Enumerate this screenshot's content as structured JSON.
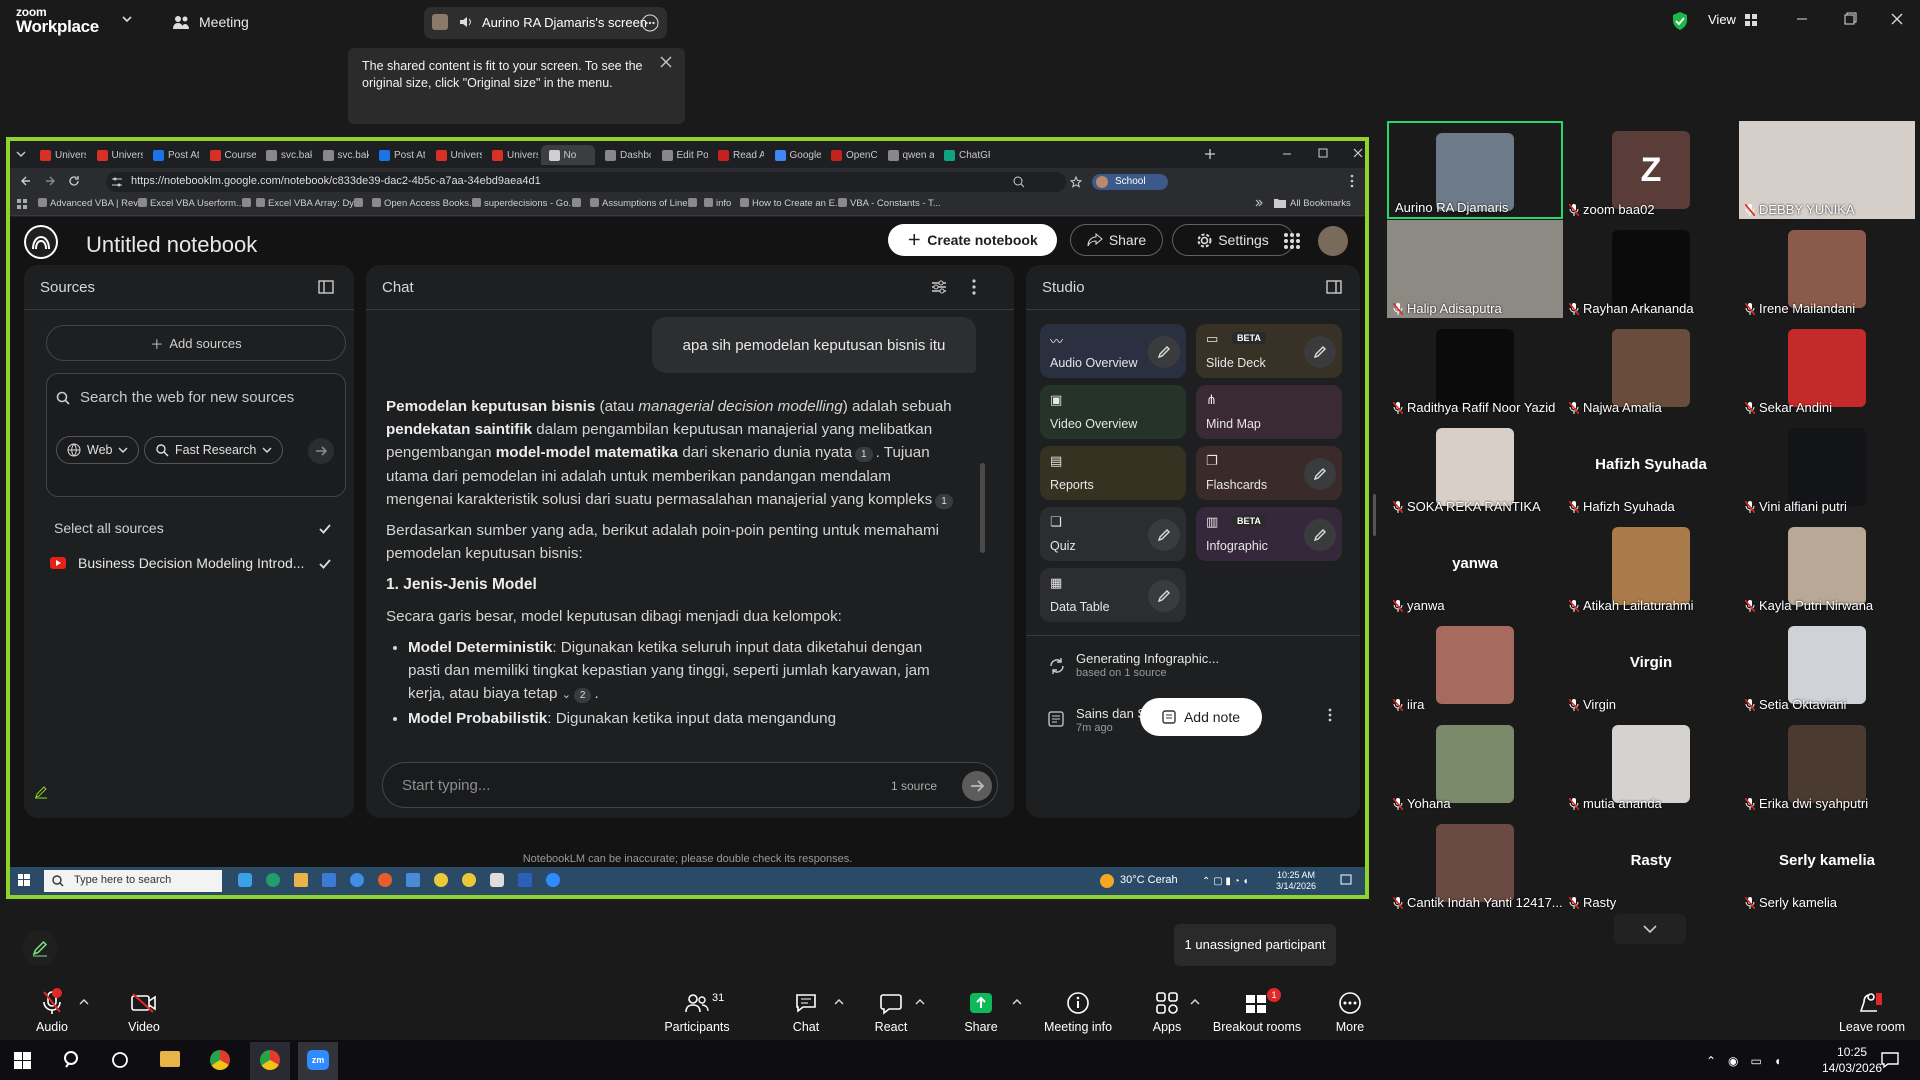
{
  "zoom": {
    "logo_small": "zoom",
    "logo_big": "Workplace",
    "meeting_label": "Meeting",
    "share_title": "Aurino RA Djamaris's screen",
    "view_label": "View",
    "notice": "The shared content is fit to your screen. To see the original size, click \"Original size\" in the menu.",
    "unassigned": "1 unassigned participant",
    "controls": {
      "audio": "Audio",
      "video": "Video",
      "participants": "Participants",
      "participants_count": "31",
      "chat": "Chat",
      "react": "React",
      "share": "Share",
      "meeting_info": "Meeting info",
      "apps": "Apps",
      "breakout": "Breakout rooms",
      "breakout_badge": "1",
      "more": "More",
      "leave": "Leave room"
    },
    "colors": {
      "accent": "#8fd42a",
      "share": "#0fb95a",
      "danger": "#e02828"
    }
  },
  "browser": {
    "tabs": [
      "Univers",
      "Univers",
      "Post At",
      "Course",
      "svc.bak",
      "svc.bak",
      "Post At",
      "Univers",
      "Univers",
      "No",
      "Dashbo",
      "Edit Po",
      "Read Al",
      "Google",
      "OpenCl",
      "qwen a",
      "ChatGP"
    ],
    "url": "https://notebooklm.google.com/notebook/c833de39-dac2-4b5c-a7aa-34ebd9aea4d1",
    "profile_label": "School",
    "bookmarks": [
      "Advanced VBA | Rev...",
      "Excel VBA Userform...",
      "",
      "Excel VBA Array: Dy...",
      "",
      "Open Access Books...",
      "superdecisions - Go...",
      "",
      "Assumptions of Line...",
      "",
      "info",
      "How to Create an E...",
      "VBA - Constants - T..."
    ],
    "all_bookmarks": "All Bookmarks"
  },
  "notebook": {
    "title": "Untitled notebook",
    "create_label": "Create notebook",
    "share_label": "Share",
    "settings_label": "Settings",
    "sources": {
      "title": "Sources",
      "add_label": "Add sources",
      "search_placeholder": "Search the web for new sources",
      "web_chip": "Web",
      "research_chip": "Fast Research",
      "select_all": "Select all sources",
      "item": "Business Decision Modeling Introd..."
    },
    "chat": {
      "title": "Chat",
      "user_msg": "apa sih  pemodelan keputusan bisnis itu",
      "input_placeholder": "Start typing...",
      "source_count": "1 source",
      "answer": {
        "p1_b1": "Pemodelan keputusan bisnis",
        "p1_t1": " (atau ",
        "p1_i1": "managerial decision modelling",
        "p1_t2": ") adalah sebuah ",
        "p1_b2": "pendekatan saintifik",
        "p1_t3": " dalam pengambilan keputusan manajerial yang melibatkan pengembangan ",
        "p1_b3": "model-model matematika",
        "p1_t4": " dari skenario dunia nyata",
        "ref1": "1",
        "p1_t5": ". Tujuan utama dari pemodelan ini adalah untuk memberikan pandangan mendalam mengenai karakteristik solusi dari suatu permasalahan manajerial yang kompleks",
        "ref2": "1",
        "p2": "Berdasarkan sumber yang ada, berikut adalah poin-poin penting untuk memahami pemodelan keputusan bisnis:",
        "h1": "1. Jenis-Jenis Model",
        "p3": "Secara garis besar, model keputusan dibagi menjadi dua kelompok:",
        "li1_b": "Model Deterministik",
        "li1_t": ": Digunakan ketika seluruh input data diketahui dengan pasti dan memiliki tingkat kepastian yang tinggi, seperti jumlah karyawan, jam kerja, atau biaya tetap",
        "ref3": "2",
        "li2_b": "Model Probabilistik",
        "li2_t": ": Digunakan ketika input data mengandung"
      }
    },
    "studio": {
      "title": "Studio",
      "tiles": [
        "Audio Overview",
        "Slide Deck",
        "Video Overview",
        "Mind Map",
        "Reports",
        "Flashcards",
        "Quiz",
        "Infographic",
        "Data Table"
      ],
      "beta": "BETA",
      "generating": "Generating Infographic...",
      "generating_sub": "based on 1 source",
      "note_title": "Sains dan Strategi Pemodelan...",
      "note_time": "7m ago",
      "add_note": "Add note"
    },
    "disclaimer": "NotebookLM can be inaccurate; please double check its responses."
  },
  "inner_taskbar": {
    "search": "Type here to search",
    "weather": "30°C  Cerah",
    "time": "10:25 AM",
    "date": "3/14/2026"
  },
  "participants": [
    {
      "name": "Aurino RA Djamaris",
      "muted": false,
      "color": "#6d7a8a"
    },
    {
      "name": "zoom baa02",
      "muted": true,
      "initial": "Z",
      "color": "#5a3d38"
    },
    {
      "name": "DEBBY YUNIKA",
      "muted": true,
      "color": "#c9bfbb"
    },
    {
      "name": "Halip Adisaputra",
      "muted": true,
      "color": "#8f8a82"
    },
    {
      "name": "Rayhan Arkananda",
      "muted": true,
      "color": "#0b0b0b"
    },
    {
      "name": "Irene Mailandani",
      "muted": true,
      "color": "#8a5a4a"
    },
    {
      "name": "Radithya Rafif Noor Yazid",
      "muted": true,
      "color": "#0b0b0b"
    },
    {
      "name": "Najwa Amalia",
      "muted": true,
      "color": "#6a4c3c"
    },
    {
      "name": "Sekar Andini",
      "muted": true,
      "color": "#c42a2a"
    },
    {
      "name": "SOKA REKA RANTIKA",
      "muted": true,
      "color": "#d8cfc8"
    },
    {
      "name": "Hafizh Syuhada",
      "muted": true,
      "big": "Hafizh Syuhada"
    },
    {
      "name": "Vini alfiani putri",
      "muted": true,
      "color": "#121418"
    },
    {
      "name": "yanwa",
      "muted": true,
      "big": "yanwa"
    },
    {
      "name": "Atikah Lailaturahmi",
      "muted": true,
      "color": "#a97b4b"
    },
    {
      "name": "Kayla Putri Nirwana",
      "muted": true,
      "color": "#b9a896"
    },
    {
      "name": "iira",
      "muted": true,
      "color": "#a76a5e"
    },
    {
      "name": "Virgin",
      "muted": true,
      "big": "Virgin"
    },
    {
      "name": "Setia Oktaviani",
      "muted": true,
      "color": "#cfd2d6"
    },
    {
      "name": "Yohana",
      "muted": true,
      "color": "#7a8a6a"
    },
    {
      "name": "mutia ananda",
      "muted": true,
      "color": "#d6d2cf"
    },
    {
      "name": "Erika dwi syahputri",
      "muted": true,
      "color": "#4a3a30"
    },
    {
      "name": "Cantik Indah Yanti 12417...",
      "muted": true,
      "color": "#6c4a44"
    },
    {
      "name": "Rasty",
      "muted": true,
      "big": "Rasty"
    },
    {
      "name": "Serly kamelia",
      "muted": true,
      "big": "Serly kamelia"
    }
  ],
  "taskbar": {
    "time": "10:25",
    "date": "14/03/2026"
  }
}
